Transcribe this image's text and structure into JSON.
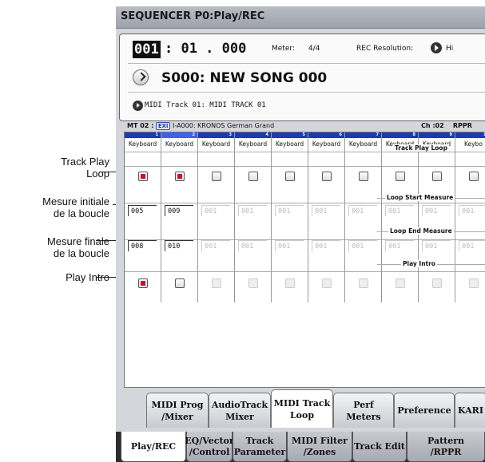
{
  "annotations": [
    {
      "text": "Track Play\nLoop"
    },
    {
      "text": "Mesure initiale\nde la boucle"
    },
    {
      "text": "Mesure finale\nde la boucle"
    },
    {
      "text": "Play Intro"
    }
  ],
  "title": "SEQUENCER P0:Play/REC",
  "position": {
    "measure": "001",
    "rest": ": 01  . 000"
  },
  "meter": {
    "label": "Meter:",
    "value": "4/4"
  },
  "rec_resolution": {
    "label": "REC Resolution:",
    "value": "Hi"
  },
  "song": {
    "name": "S000: NEW SONG 000"
  },
  "track": {
    "name": "MIDI Track 01: MIDI TRACK 01"
  },
  "mt_info": {
    "prefix": "MT 02 :",
    "badge": "EXi",
    "program": "I-A000: KRONOS German Grand",
    "channel": "Ch :02",
    "mode": "RPPR"
  },
  "columns": [
    {
      "num": "1",
      "type": "Keyboard",
      "loop": true,
      "start": "005",
      "end": "008",
      "intro": true,
      "enabled": true
    },
    {
      "num": "2",
      "type": "Keyboard",
      "loop": true,
      "start": "009",
      "end": "010",
      "intro": false,
      "enabled": true
    },
    {
      "num": "3",
      "type": "Keyboard",
      "loop": false,
      "start": "001",
      "end": "001",
      "intro": false,
      "enabled": false
    },
    {
      "num": "4",
      "type": "Keyboard",
      "loop": false,
      "start": "001",
      "end": "001",
      "intro": false,
      "enabled": false
    },
    {
      "num": "5",
      "type": "Keyboard",
      "loop": false,
      "start": "001",
      "end": "001",
      "intro": false,
      "enabled": false
    },
    {
      "num": "6",
      "type": "Keyboard",
      "loop": false,
      "start": "001",
      "end": "001",
      "intro": false,
      "enabled": false
    },
    {
      "num": "7",
      "type": "Keyboard",
      "loop": false,
      "start": "001",
      "end": "001",
      "intro": false,
      "enabled": false
    },
    {
      "num": "8",
      "type": "Keyboard",
      "loop": false,
      "start": "001",
      "end": "001",
      "intro": false,
      "enabled": false
    },
    {
      "num": "9",
      "type": "Keyboard",
      "loop": false,
      "start": "001",
      "end": "001",
      "intro": false,
      "enabled": false
    },
    {
      "num": "10",
      "type": "Keybo",
      "loop": false,
      "start": "001",
      "end": "001",
      "intro": false,
      "enabled": false
    }
  ],
  "row_labels": {
    "loop": "Track Play Loop",
    "start": "Loop Start Measure",
    "end": "Loop End Measure",
    "intro": "Play Intro"
  },
  "tabs_top": [
    {
      "label": "MIDI Prog\n/Mixer"
    },
    {
      "label": "AudioTrack\nMixer"
    },
    {
      "label": "MIDI Track\nLoop",
      "active": true
    },
    {
      "label": "Perf\nMeters"
    },
    {
      "label": "Preference"
    },
    {
      "label": "KARI"
    }
  ],
  "tabs_bottom": [
    {
      "label": "Play/REC",
      "active": true
    },
    {
      "label": "EQ/Vector\n/Control"
    },
    {
      "label": "Track\nParameter"
    },
    {
      "label": "MIDI Filter\n/Zones"
    },
    {
      "label": "Track Edit"
    },
    {
      "label": "Pattern\n/RPPR"
    }
  ],
  "colors": {
    "checked": "#c8102e",
    "header_blue": "#1f3ab0",
    "header_selected": "#3d63ee"
  }
}
